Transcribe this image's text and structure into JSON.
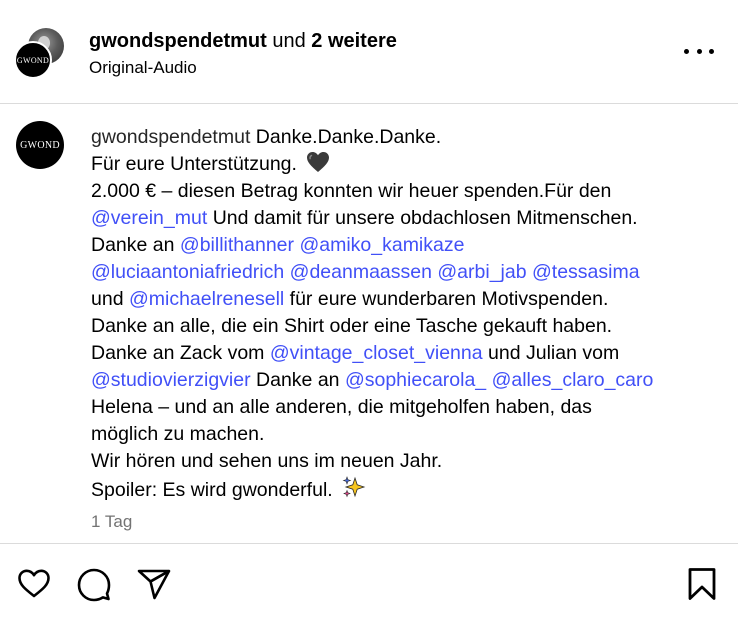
{
  "header": {
    "username": "gwondspendetmut",
    "connector": "und",
    "others": "2 weitere",
    "audio": "Original-Audio",
    "logo_text": "GWOND",
    "more_icon": "more-horizontal-icon"
  },
  "caption": {
    "logo_text": "GWOND",
    "username": "gwondspendetmut",
    "text_1": "Danke.Danke.Danke.",
    "text_2": "Für eure Unterstützung.",
    "emoji_heart": "black-heart-emoji",
    "text_3": "2.000 € – diesen Betrag konnten wir heuer spenden.Für den",
    "mention_verein": "@verein_mut",
    "text_4": "Und damit für unsere obdachlosen Mitmenschen.",
    "text_5": "Danke an",
    "mention_billi": "@billithanner",
    "mention_amiko": "@amiko_kamikaze",
    "mention_lucia": "@luciaantoniafriedrich",
    "mention_dean": "@deanmaassen",
    "mention_arbi": "@arbi_jab",
    "mention_tessa": "@tessasima",
    "text_6": "und",
    "mention_michael": "@michaelrenesell",
    "text_7": "für eure wunderbaren Motivspenden.",
    "text_8": "Danke an alle, die ein Shirt oder eine Tasche gekauft haben.",
    "text_9": "Danke an Zack vom",
    "mention_vintage": "@vintage_closet_vienna",
    "text_10": "und Julian vom",
    "mention_studio": "@studiovierzigvier",
    "text_11": "Danke an",
    "mention_sophie": "@sophiecarola_",
    "mention_alles": "@alles_claro_caro",
    "text_12": "Helena – und an alle anderen, die mitgeholfen haben, das",
    "text_13": "möglich zu machen.",
    "text_14": "Wir hören und sehen uns im neuen Jahr.",
    "text_15": "Spoiler: Es wird gwonderful.",
    "emoji_sparkles": "sparkles-emoji",
    "timestamp": "1 Tag"
  },
  "actions": {
    "like_icon": "heart-icon",
    "comment_icon": "comment-icon",
    "share_icon": "send-icon",
    "save_icon": "bookmark-icon"
  },
  "colors": {
    "mention": "#4150f7",
    "timestamp": "#737373",
    "divider": "#dbdbdb"
  }
}
